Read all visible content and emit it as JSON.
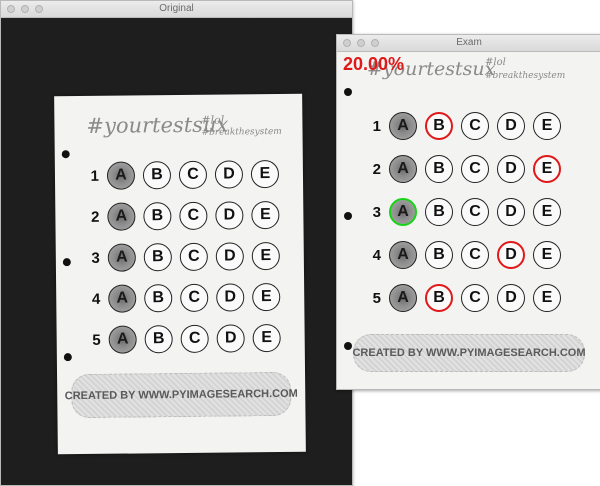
{
  "windows": {
    "original": {
      "title": "Original"
    },
    "exam": {
      "title": "Exam",
      "score": "20.00%"
    }
  },
  "sheet": {
    "handwriting_1": "#yourtestsux",
    "handwriting_2": "#lol",
    "handwriting_3": "#breakthesystem",
    "credit": "CREATED BY WWW.PYIMAGESEARCH.COM",
    "questions": [
      {
        "num": "1",
        "choices": [
          "A",
          "B",
          "C",
          "D",
          "E"
        ],
        "marked": "A",
        "correct": "B"
      },
      {
        "num": "2",
        "choices": [
          "A",
          "B",
          "C",
          "D",
          "E"
        ],
        "marked": "A",
        "correct": "E"
      },
      {
        "num": "3",
        "choices": [
          "A",
          "B",
          "C",
          "D",
          "E"
        ],
        "marked": "A",
        "correct": "A"
      },
      {
        "num": "4",
        "choices": [
          "A",
          "B",
          "C",
          "D",
          "E"
        ],
        "marked": "A",
        "correct": "D"
      },
      {
        "num": "5",
        "choices": [
          "A",
          "B",
          "C",
          "D",
          "E"
        ],
        "marked": "A",
        "correct": "B"
      }
    ]
  },
  "colors": {
    "wrong": "#e01818",
    "right": "#17d417",
    "score": "#e01818"
  }
}
